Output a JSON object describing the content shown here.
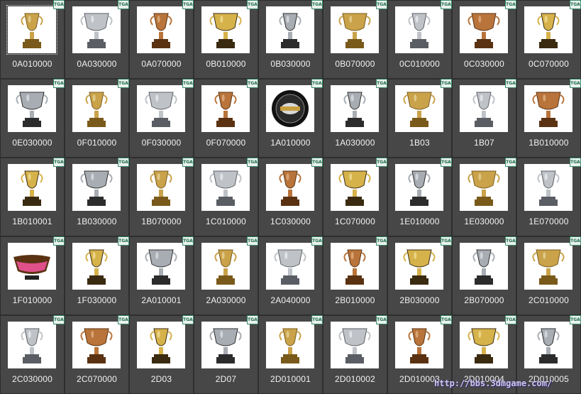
{
  "thumbnails": [
    {
      "filename": "0A010000",
      "badge": "TGA",
      "icon": "trophy-icon",
      "selected": true
    },
    {
      "filename": "0A030000",
      "badge": "TGA",
      "icon": "trophy-icon"
    },
    {
      "filename": "0A070000",
      "badge": "TGA",
      "icon": "trophy-icon"
    },
    {
      "filename": "0B010000",
      "badge": "TGA",
      "icon": "trophy-icon"
    },
    {
      "filename": "0B030000",
      "badge": "TGA",
      "icon": "trophy-icon"
    },
    {
      "filename": "0B070000",
      "badge": "TGA",
      "icon": "trophy-icon"
    },
    {
      "filename": "0C010000",
      "badge": "TGA",
      "icon": "trophy-icon"
    },
    {
      "filename": "0C030000",
      "badge": "TGA",
      "icon": "trophy-icon"
    },
    {
      "filename": "0C070000",
      "badge": "TGA",
      "icon": "trophy-icon"
    },
    {
      "filename": "0E030000",
      "badge": "TGA",
      "icon": "trophy-icon"
    },
    {
      "filename": "0F010000",
      "badge": "TGA",
      "icon": "trophy-icon"
    },
    {
      "filename": "0F030000",
      "badge": "TGA",
      "icon": "trophy-icon"
    },
    {
      "filename": "0F070000",
      "badge": "TGA",
      "icon": "trophy-icon"
    },
    {
      "filename": "1A010000",
      "badge": "TGA",
      "icon": "plate-icon"
    },
    {
      "filename": "1A030000",
      "badge": "TGA",
      "icon": "trophy-icon"
    },
    {
      "filename": "1B03",
      "badge": "TGA",
      "icon": "trophy-icon"
    },
    {
      "filename": "1B07",
      "badge": "TGA",
      "icon": "trophy-icon"
    },
    {
      "filename": "1B010000",
      "badge": "TGA",
      "icon": "trophy-icon"
    },
    {
      "filename": "1B010001",
      "badge": "TGA",
      "icon": "trophy-icon"
    },
    {
      "filename": "1B030000",
      "badge": "TGA",
      "icon": "trophy-icon"
    },
    {
      "filename": "1B070000",
      "badge": "TGA",
      "icon": "trophy-icon"
    },
    {
      "filename": "1C010000",
      "badge": "TGA",
      "icon": "trophy-icon"
    },
    {
      "filename": "1C030000",
      "badge": "TGA",
      "icon": "trophy-icon"
    },
    {
      "filename": "1C070000",
      "badge": "TGA",
      "icon": "trophy-icon"
    },
    {
      "filename": "1E010000",
      "badge": "TGA",
      "icon": "trophy-icon"
    },
    {
      "filename": "1E030000",
      "badge": "TGA",
      "icon": "trophy-icon"
    },
    {
      "filename": "1E070000",
      "badge": "TGA",
      "icon": "trophy-icon"
    },
    {
      "filename": "1F010000",
      "badge": "TGA",
      "icon": "bowl-icon"
    },
    {
      "filename": "1F030000",
      "badge": "TGA",
      "icon": "trophy-icon"
    },
    {
      "filename": "2A010001",
      "badge": "TGA",
      "icon": "trophy-icon"
    },
    {
      "filename": "2A030000",
      "badge": "TGA",
      "icon": "trophy-icon"
    },
    {
      "filename": "2A040000",
      "badge": "TGA",
      "icon": "trophy-icon"
    },
    {
      "filename": "2B010000",
      "badge": "TGA",
      "icon": "trophy-icon"
    },
    {
      "filename": "2B030000",
      "badge": "TGA",
      "icon": "trophy-icon"
    },
    {
      "filename": "2B070000",
      "badge": "TGA",
      "icon": "trophy-icon"
    },
    {
      "filename": "2C010000",
      "badge": "TGA",
      "icon": "trophy-icon"
    },
    {
      "filename": "2C030000",
      "badge": "TGA",
      "icon": "trophy-icon"
    },
    {
      "filename": "2C070000",
      "badge": "TGA",
      "icon": "trophy-icon"
    },
    {
      "filename": "2D03",
      "badge": "TGA",
      "icon": "trophy-icon"
    },
    {
      "filename": "2D07",
      "badge": "TGA",
      "icon": "trophy-icon"
    },
    {
      "filename": "2D010001",
      "badge": "TGA",
      "icon": "trophy-icon"
    },
    {
      "filename": "2D010002",
      "badge": "TGA",
      "icon": "trophy-icon"
    },
    {
      "filename": "2D010003",
      "badge": "TGA",
      "icon": "trophy-icon"
    },
    {
      "filename": "2D010004",
      "badge": "TGA",
      "icon": "trophy-icon"
    },
    {
      "filename": "2D010005",
      "badge": "TGA",
      "icon": "trophy-icon"
    }
  ],
  "watermark": "http://bbs.3dmgame.com/",
  "colors": {
    "background": "#6a6a6a",
    "cell": "#474747",
    "label": "#f2f2f2",
    "badge_border": "#3a8a6a"
  }
}
